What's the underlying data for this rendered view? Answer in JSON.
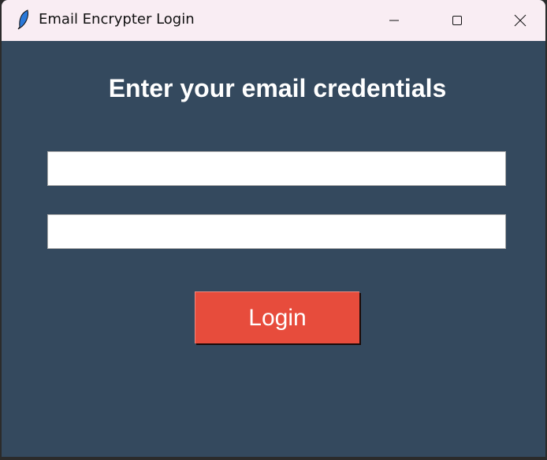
{
  "window": {
    "title": "Email Encrypter Login"
  },
  "main": {
    "heading": "Enter your email credentials",
    "email_value": "",
    "password_value": "",
    "login_label": "Login"
  }
}
